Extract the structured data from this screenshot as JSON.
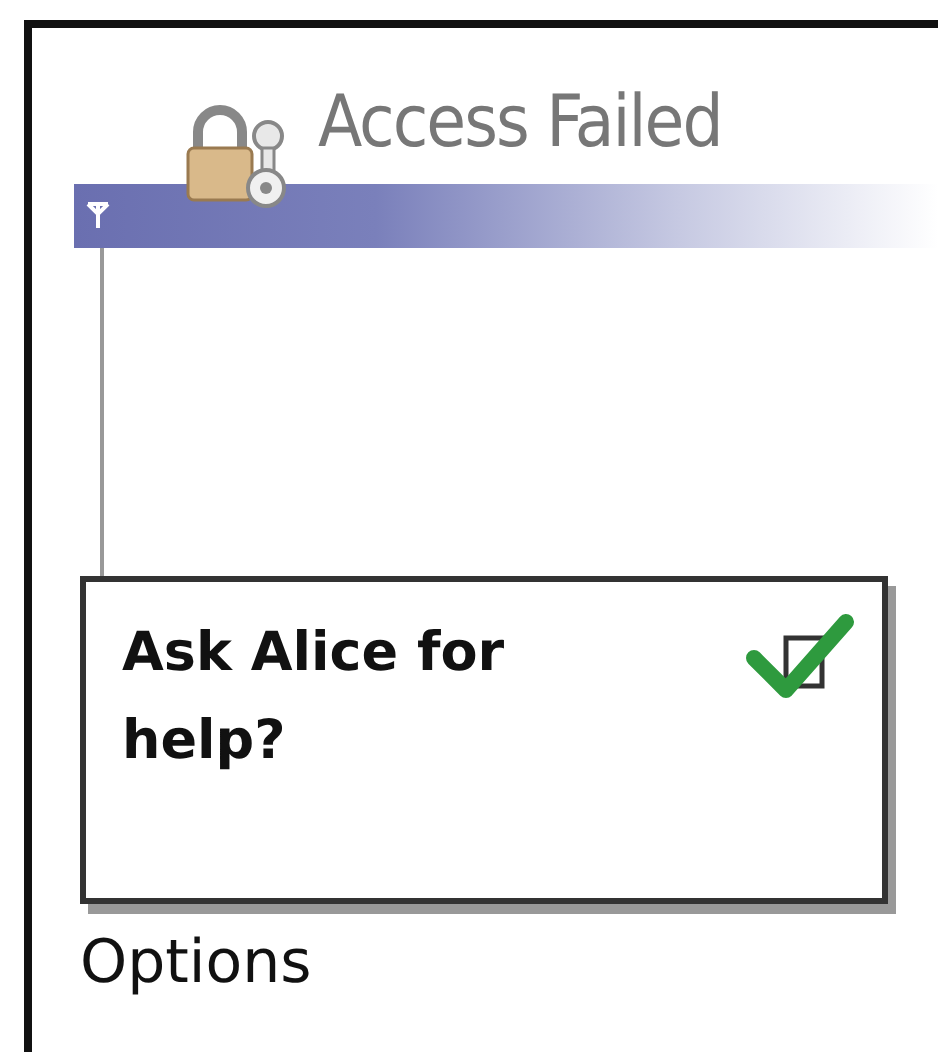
{
  "header": {
    "title": "Access Failed"
  },
  "dialog": {
    "message": "Ask Alice for help?"
  },
  "softkeys": {
    "left": "Options"
  }
}
